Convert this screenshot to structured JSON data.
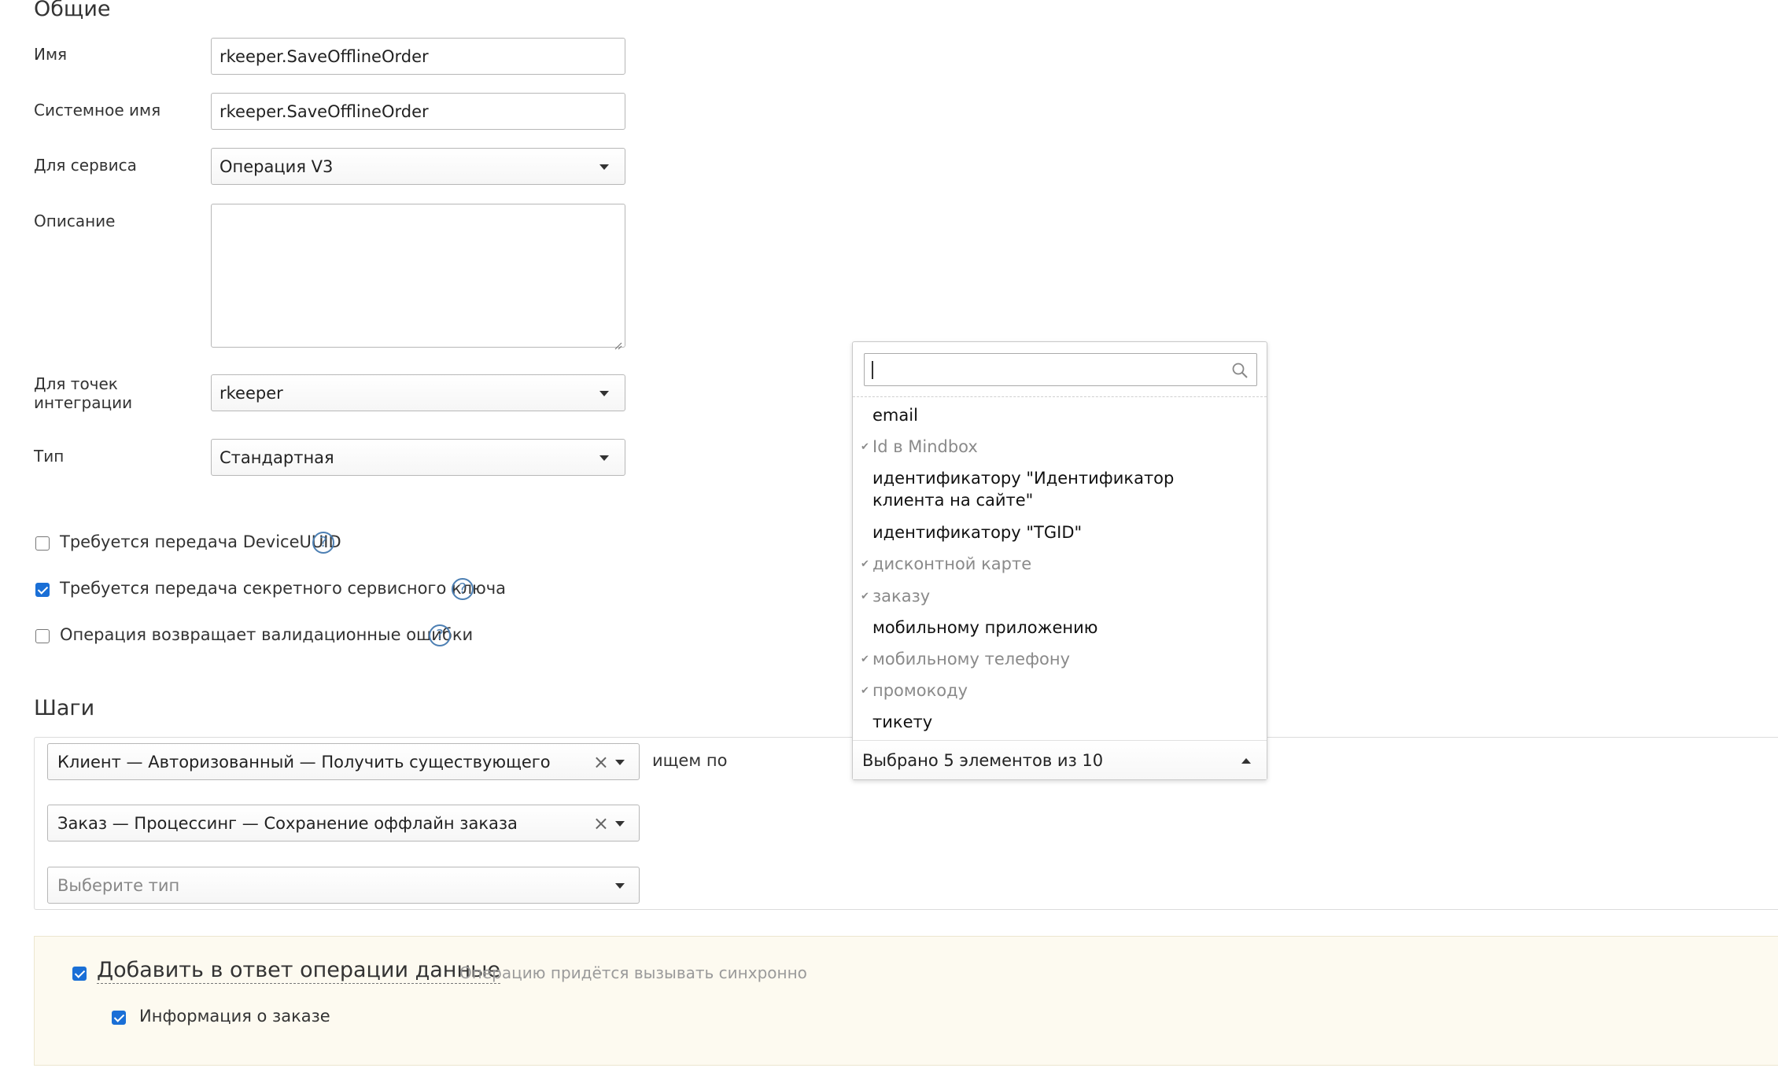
{
  "general": {
    "title": "Общие",
    "name_label": "Имя",
    "name_value": "rkeeper.SaveOfflineOrder",
    "system_name_label": "Системное имя",
    "system_name_value": "rkeeper.SaveOfflineOrder",
    "service_label": "Для сервиса",
    "service_value": "Операция V3",
    "description_label": "Описание",
    "description_value": "",
    "integration_label_1": "Для точек",
    "integration_label_2": "интеграции",
    "integration_value": "rkeeper",
    "type_label": "Тип",
    "type_value": "Стандартная"
  },
  "options": [
    {
      "label": "Требуется передача DeviceUUID",
      "checked": false,
      "help": "?"
    },
    {
      "label": "Требуется передача секретного сервисного ключа",
      "checked": true,
      "help": "?"
    },
    {
      "label": "Операция возвращает валидационные ошибки",
      "checked": false,
      "help": "?"
    }
  ],
  "steps": {
    "title": "Шаги",
    "step1": "Клиент — Авторизованный — Получить существующего",
    "search_by_label": "ищем по",
    "step2": "Заказ — Процессинг — Сохранение оффлайн заказа",
    "step3_placeholder": "Выберите тип"
  },
  "dropdown": {
    "search_value": "",
    "items": [
      {
        "label": "email",
        "selected": false
      },
      {
        "label": "Id в Mindbox",
        "selected": true
      },
      {
        "label": "идентификатору \"Идентификатор клиента на сайте\"",
        "selected": false
      },
      {
        "label": "идентификатору \"TGID\"",
        "selected": false
      },
      {
        "label": "дисконтной карте",
        "selected": true
      },
      {
        "label": "заказу",
        "selected": true
      },
      {
        "label": "мобильному приложению",
        "selected": false
      },
      {
        "label": "мобильному телефону",
        "selected": true
      },
      {
        "label": "промокоду",
        "selected": true
      },
      {
        "label": "тикету",
        "selected": false
      }
    ],
    "summary": "Выбрано 5 элементов из 10"
  },
  "response": {
    "add_data_label": "Добавить в ответ операции данные",
    "add_data_checked": true,
    "sync_note": "Операцию придётся вызывать синхронно",
    "order_info_label": "Информация о заказе",
    "order_info_checked": true
  },
  "colors": {
    "accent": "#1a6fd6",
    "help": "#4c7fb3",
    "muted": "#8a8a8a",
    "answer_bg": "#fdfaf0"
  }
}
